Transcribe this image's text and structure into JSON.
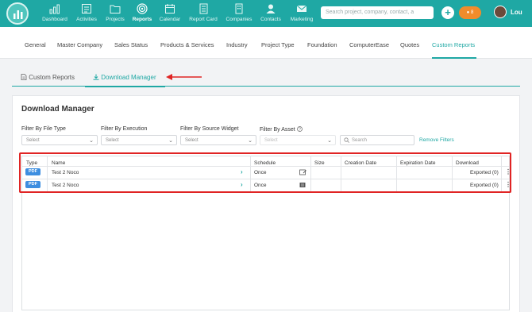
{
  "nav": {
    "items": [
      {
        "label": "Dashboard",
        "icon": "bar-chart-icon"
      },
      {
        "label": "Activities",
        "icon": "calendar-list-icon"
      },
      {
        "label": "Projects",
        "icon": "folder-icon"
      },
      {
        "label": "Reports",
        "icon": "target-icon"
      },
      {
        "label": "Calendar",
        "icon": "calendar-icon"
      },
      {
        "label": "Report Card",
        "icon": "report-card-icon"
      },
      {
        "label": "Companies",
        "icon": "building-icon"
      },
      {
        "label": "Contacts",
        "icon": "person-icon"
      },
      {
        "label": "Marketing",
        "icon": "envelope-icon"
      }
    ],
    "active": "Reports",
    "search_placeholder": "Search project, company, contact, a",
    "plus": "+",
    "notifications": "8",
    "user_name": "Lou"
  },
  "category_tabs": [
    "General",
    "Master Company",
    "Sales Status",
    "Products & Services",
    "Industry",
    "Project Type",
    "Foundation",
    "ComputerEase",
    "Quotes",
    "Custom Reports"
  ],
  "active_category": "Custom Reports",
  "subtabs": {
    "custom_reports": "Custom Reports",
    "download_manager": "Download Manager"
  },
  "panel": {
    "title": "Download Manager",
    "filters": {
      "file_type": {
        "label": "Filter By File Type",
        "value": "Select"
      },
      "execution": {
        "label": "Filter By Execution",
        "value": "Select"
      },
      "source_widget": {
        "label": "Filter By Source Widget",
        "value": "Select"
      },
      "asset": {
        "label": "Filter By Asset",
        "value": "Select"
      }
    },
    "search_placeholder": "Search",
    "remove_filters": "Remove Filters"
  },
  "table": {
    "headers": {
      "type": "Type",
      "name": "Name",
      "schedule": "Schedule",
      "size": "Size",
      "creation_date": "Creation Date",
      "expiration_date": "Expiration Date",
      "download": "Download"
    },
    "rows": [
      {
        "type": "PDF",
        "name": "Test 2 Noco",
        "schedule": "Once",
        "size": "",
        "creation_date": "",
        "expiration_date": "",
        "download": "Exported (0)"
      },
      {
        "type": "PDF",
        "name": "Test 2 Noco",
        "schedule": "Once",
        "size": "",
        "creation_date": "",
        "expiration_date": "",
        "download": "Exported (0)"
      }
    ]
  },
  "colors": {
    "brand": "#1fa8a4",
    "badge": "#f08c2b",
    "pdf_badge": "#3d8ee0",
    "highlight": "#e02424"
  }
}
